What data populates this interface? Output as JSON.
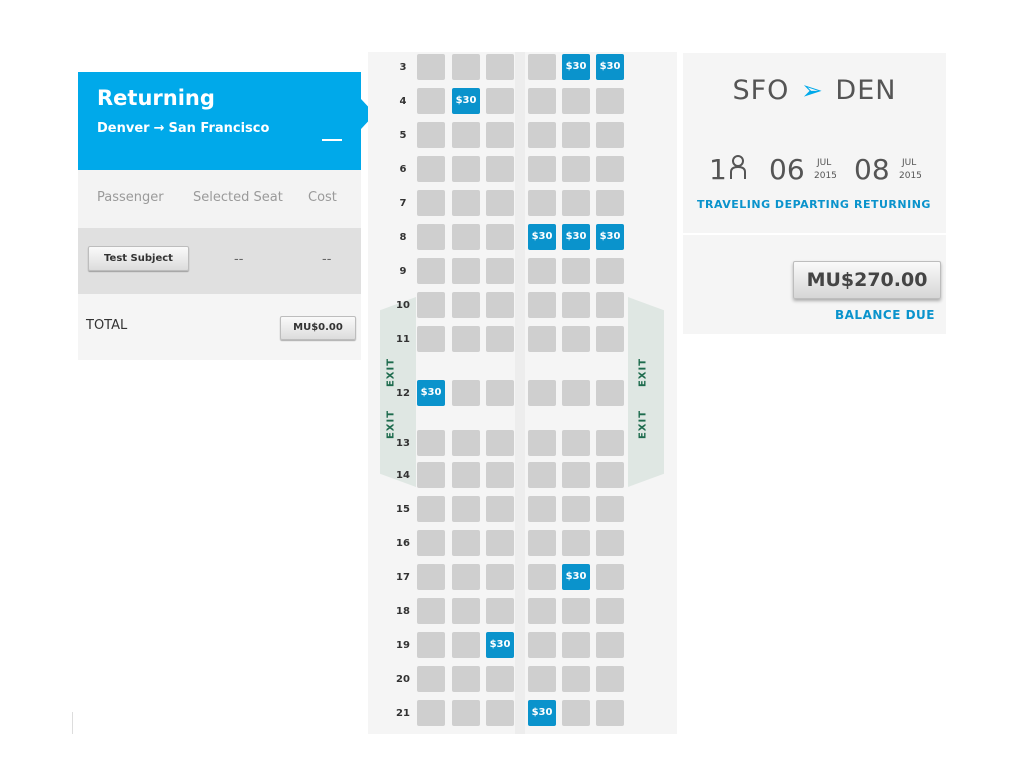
{
  "header": {
    "title": "Returning",
    "route_from": "Denver",
    "route_arrow": "→",
    "route_to": "San Francisco"
  },
  "table": {
    "columns": [
      "Passenger",
      "Selected Seat",
      "Cost"
    ],
    "passenger": {
      "name": "Test Subject",
      "selected_seat": "--",
      "cost": "--"
    },
    "total_label": "TOTAL",
    "total_value": "MU$0.00"
  },
  "seatmap": {
    "exit_label": "EXIT",
    "rows": [
      "3",
      "4",
      "5",
      "6",
      "7",
      "8",
      "9",
      "10",
      "11",
      "12",
      "13",
      "14",
      "15",
      "16",
      "17",
      "18",
      "19",
      "20",
      "21"
    ],
    "paid_seat_label": "$30",
    "paid_seats": [
      {
        "row": "3",
        "seat": "E"
      },
      {
        "row": "3",
        "seat": "F"
      },
      {
        "row": "4",
        "seat": "B"
      },
      {
        "row": "8",
        "seat": "D"
      },
      {
        "row": "8",
        "seat": "E"
      },
      {
        "row": "8",
        "seat": "F"
      },
      {
        "row": "12",
        "seat": "A"
      },
      {
        "row": "17",
        "seat": "E"
      },
      {
        "row": "19",
        "seat": "C"
      },
      {
        "row": "21",
        "seat": "D"
      }
    ]
  },
  "summary": {
    "origin": "SFO",
    "destination": "DEN",
    "travelers": "1",
    "depart_day": "06",
    "depart_month": "JUL",
    "depart_year": "2015",
    "return_day": "08",
    "return_month": "JUL",
    "return_year": "2015",
    "label_traveling_departing": "TRAVELING DEPARTING",
    "label_returning": "RETURNING",
    "balance": "MU$270.00",
    "balance_label": "BALANCE DUE"
  },
  "colors": {
    "accent": "#00a9ea",
    "seat_paid": "#0a93cc",
    "seat_available": "#cfcfcf",
    "exit_text": "#1d6b4d"
  }
}
